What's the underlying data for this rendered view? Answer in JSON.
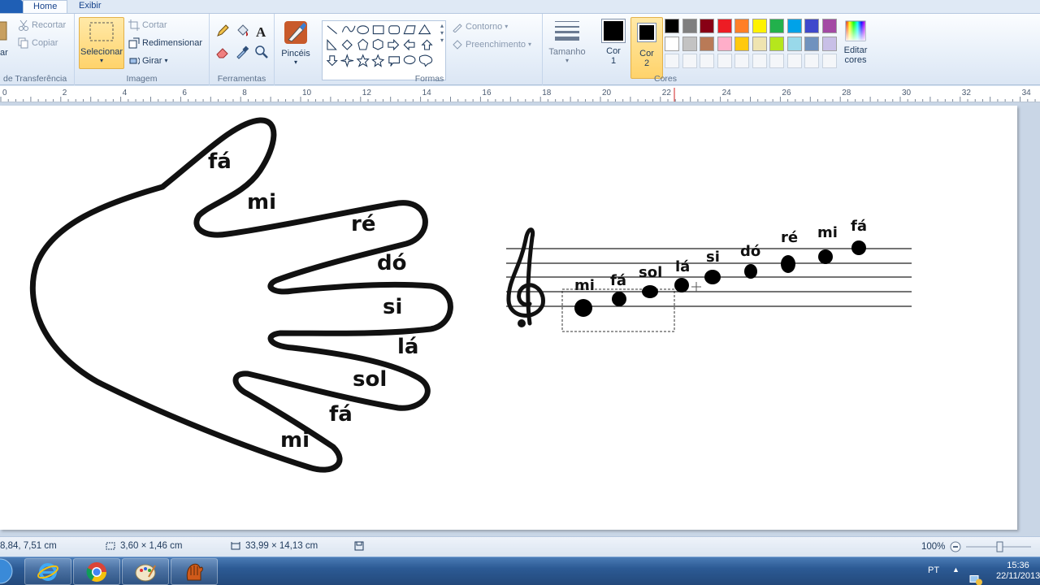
{
  "tabs": [
    {
      "label": "Home",
      "active": true
    },
    {
      "label": "Exibir",
      "active": false
    }
  ],
  "clipboard": {
    "paste_label": "ar",
    "cut_label": "Recortar",
    "copy_label": "Copiar",
    "group_label": "de Transferência"
  },
  "image": {
    "select_label": "Selecionar",
    "crop_label": "Cortar",
    "resize_label": "Redimensionar",
    "rotate_label": "Girar",
    "group_label": "Imagem"
  },
  "tools": {
    "group_label": "Ferramentas",
    "items": [
      "pencil-icon",
      "fill-icon",
      "text-icon",
      "eraser-icon",
      "color-picker-icon",
      "magnifier-icon"
    ]
  },
  "brushes": {
    "label": "Pincéis"
  },
  "shapes": {
    "outline_label": "Contorno",
    "fill_label": "Preenchimento",
    "group_label": "Formas"
  },
  "size": {
    "label": "Tamanho"
  },
  "colors": {
    "color1_label": "Cor",
    "color1_num": "1",
    "color2_label": "Cor",
    "color2_num": "2",
    "edit_label": "Editar",
    "edit_label2": "cores",
    "group_label": "Cores",
    "color1_value": "#000000",
    "color2_value": "#000000",
    "palette_row1": [
      "#000000",
      "#7f7f7f",
      "#880015",
      "#ed1c24",
      "#ff7f27",
      "#fff200",
      "#22b14c",
      "#00a2e8",
      "#3f48cc",
      "#a349a4"
    ],
    "palette_row2": [
      "#ffffff",
      "#c3c3c3",
      "#b97a57",
      "#ffaec9",
      "#ffc90e",
      "#efe4b0",
      "#b5e61d",
      "#99d9ea",
      "#7092be",
      "#c8bfe7"
    ]
  },
  "ruler": {
    "ticks": [
      "0",
      "2",
      "4",
      "6",
      "8",
      "10",
      "12",
      "14",
      "16",
      "18",
      "20",
      "22",
      "24",
      "26",
      "28",
      "30",
      "32",
      "34"
    ]
  },
  "hand": {
    "notes": [
      "fá",
      "mi",
      "ré",
      "dó",
      "si",
      "lá",
      "sol",
      "fá",
      "mi"
    ]
  },
  "staff": {
    "labels": [
      "mi",
      "fá",
      "sol",
      "lá",
      "si",
      "dó",
      "ré",
      "mi",
      "fá"
    ]
  },
  "status": {
    "cursor_pos": "8,84, 7,51 cm",
    "selection_size": "3,60 × 1,46 cm",
    "image_size": "33,99 × 14,13 cm",
    "zoom": "100%"
  },
  "taskbar": {
    "lang": "PT",
    "time": "15:36",
    "date": "22/11/2013"
  }
}
